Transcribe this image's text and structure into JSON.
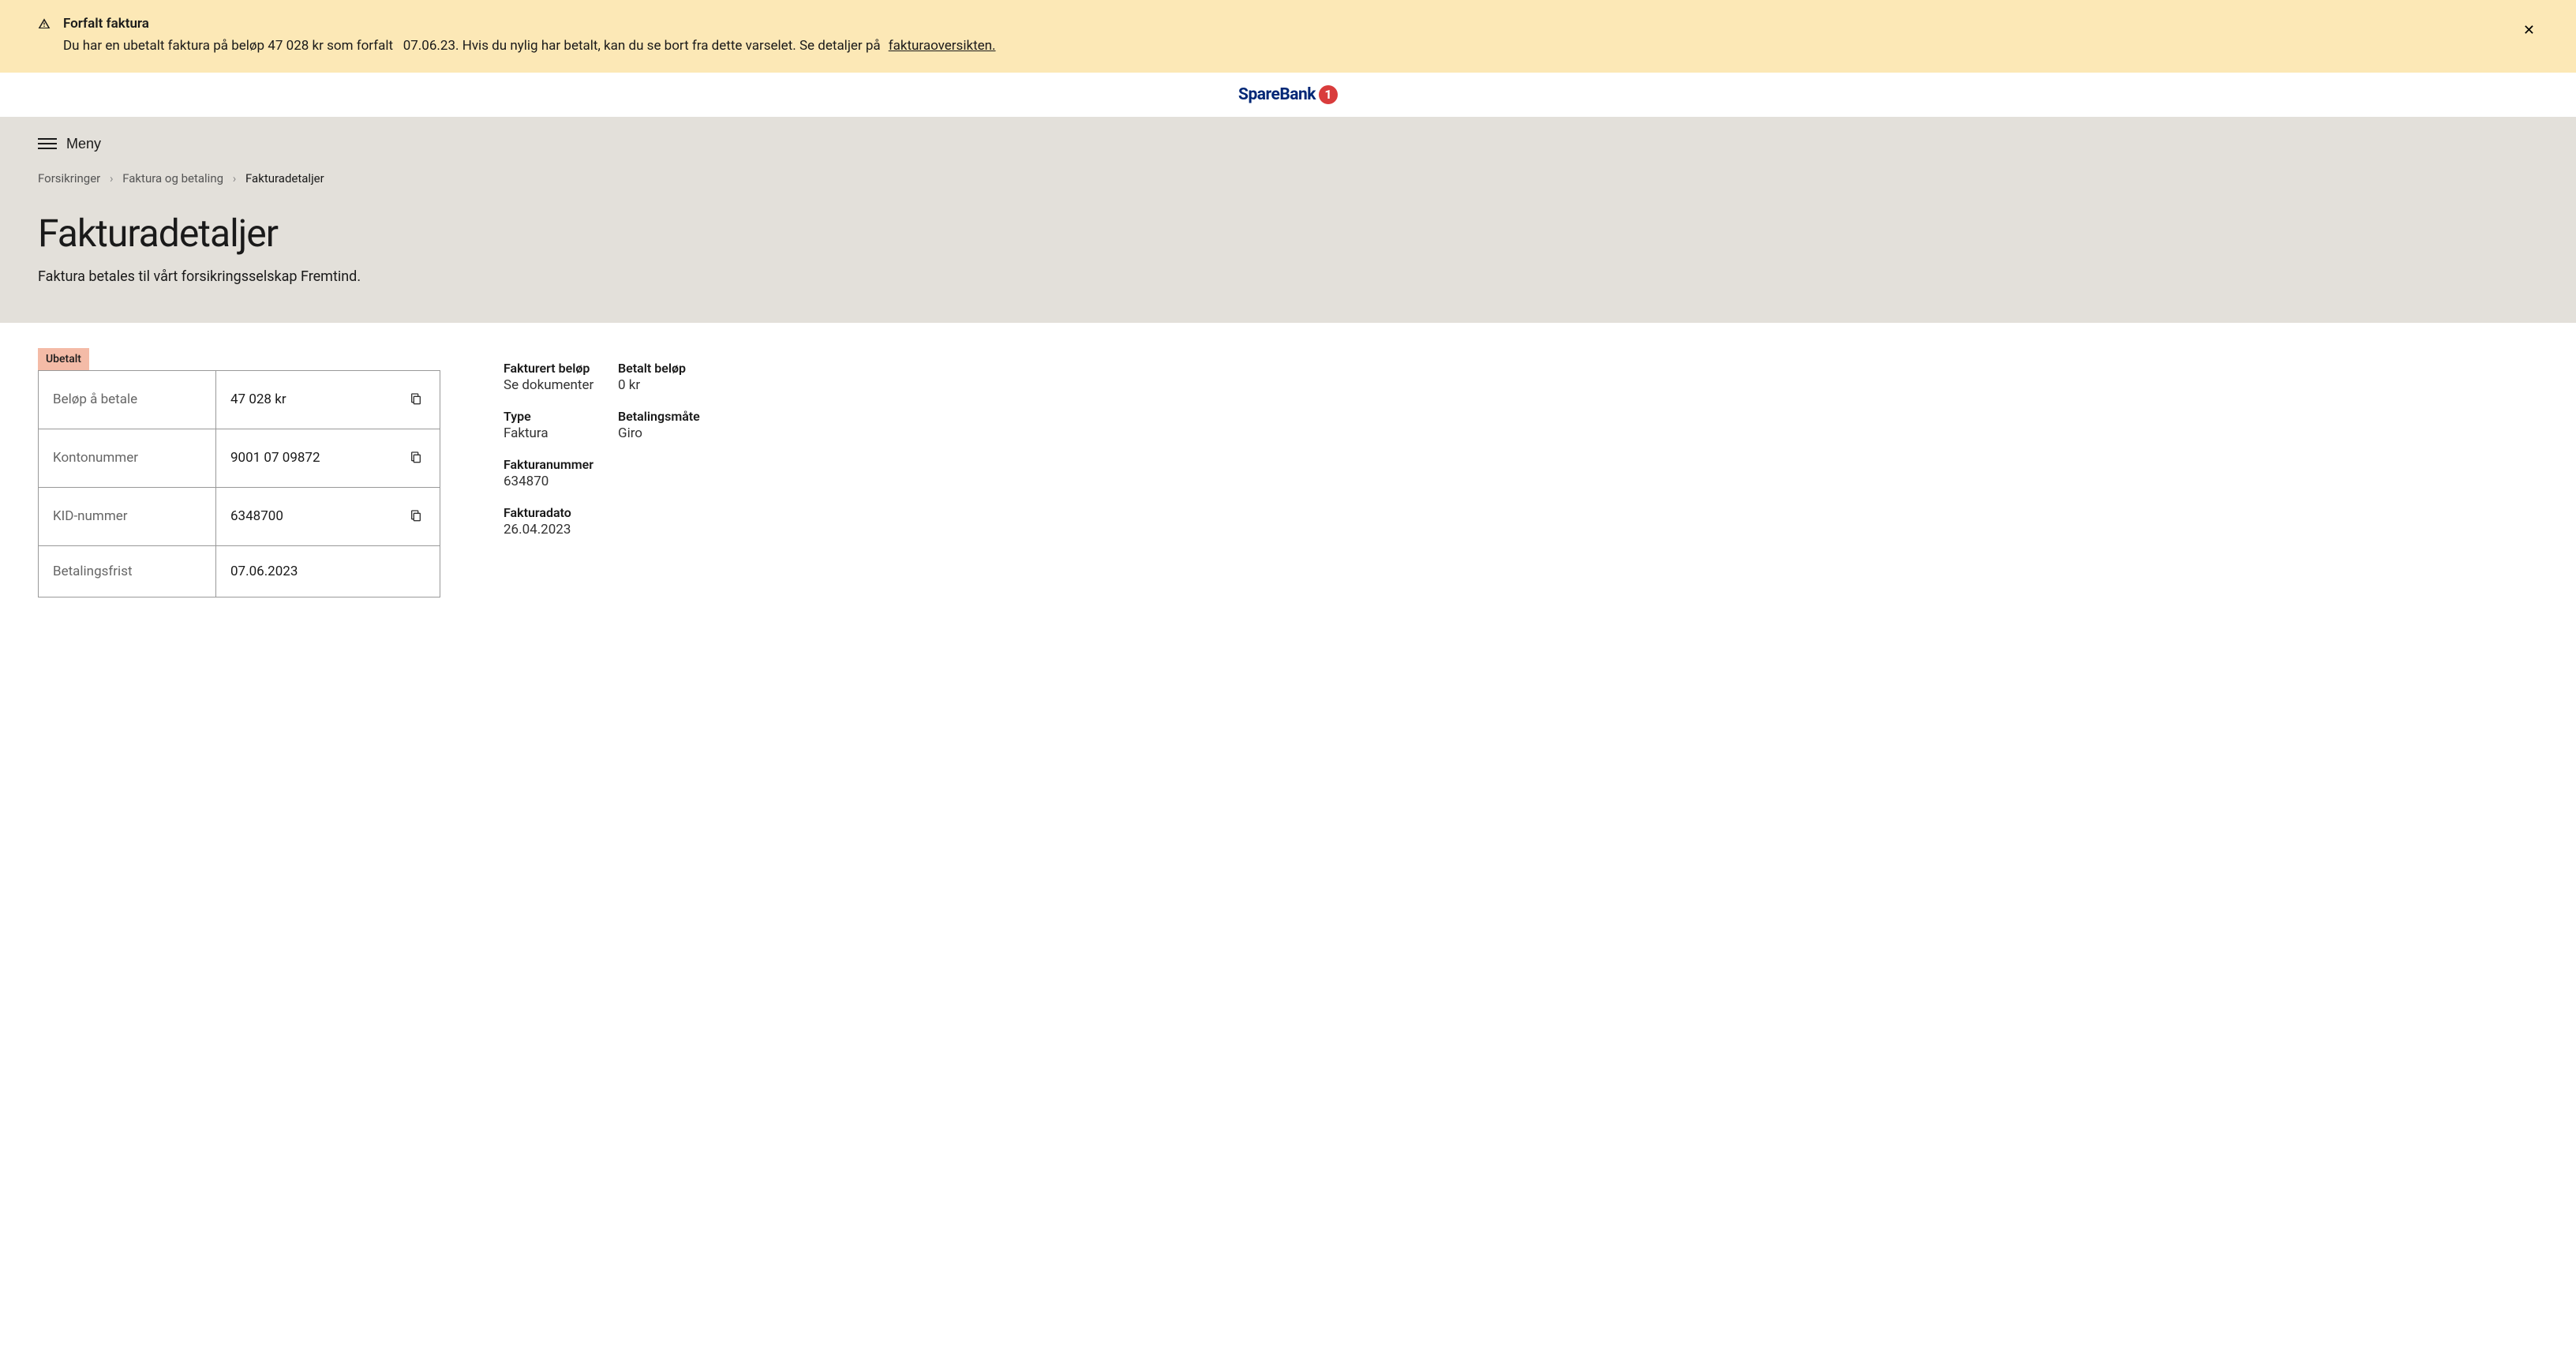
{
  "alert": {
    "title": "Forfalt faktura",
    "message_part1": "Du har en ubetalt faktura på beløp 47 028 kr som forfalt",
    "message_part2": "07.06.23. Hvis du nylig har betalt, kan du se bort fra dette varselet. Se detaljer på",
    "link_text": "fakturaoversikten."
  },
  "logo": {
    "text": "SpareBank",
    "badge": "1"
  },
  "menu": {
    "label": "Meny"
  },
  "breadcrumb": {
    "items": [
      {
        "label": "Forsikringer"
      },
      {
        "label": "Faktura og betaling"
      }
    ],
    "current": "Fakturadetaljer"
  },
  "header": {
    "title": "Fakturadetaljer",
    "subtitle": "Faktura betales til vårt forsikringsselskap Fremtind."
  },
  "status_badge": "Ubetalt",
  "payment_table": {
    "rows": [
      {
        "label": "Beløp å betale",
        "value": "47 028 kr",
        "copyable": true
      },
      {
        "label": "Kontonummer",
        "value": "9001 07 09872",
        "copyable": true
      },
      {
        "label": "KID-nummer",
        "value": "6348700",
        "copyable": true
      },
      {
        "label": "Betalingsfrist",
        "value": "07.06.2023",
        "copyable": false
      }
    ]
  },
  "info": {
    "items": [
      {
        "label": "Fakturert beløp",
        "value": "Se dokumenter"
      },
      {
        "label": "Betalt beløp",
        "value": "0 kr"
      },
      {
        "label": "Type",
        "value": "Faktura"
      },
      {
        "label": "Betalingsmåte",
        "value": "Giro"
      },
      {
        "label": "Fakturanummer",
        "value": "634870"
      },
      {
        "label": "Fakturadato",
        "value": "26.04.2023"
      }
    ]
  }
}
